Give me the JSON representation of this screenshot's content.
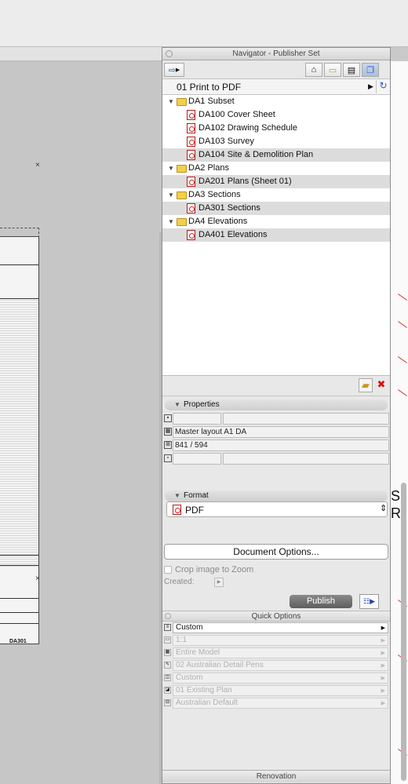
{
  "palette": {
    "title": "Navigator - Publisher Set",
    "publisher_set": "01 Print to PDF"
  },
  "tree": [
    {
      "label": "DA1 Subset",
      "kind": "folder",
      "level": 0,
      "selected": false
    },
    {
      "label": "DA100 Cover Sheet",
      "kind": "pdf",
      "level": 1,
      "selected": false
    },
    {
      "label": "DA102 Drawing Schedule",
      "kind": "pdf",
      "level": 1,
      "selected": false
    },
    {
      "label": "DA103 Survey",
      "kind": "pdf",
      "level": 1,
      "selected": false
    },
    {
      "label": "DA104 Site & Demolition Plan",
      "kind": "pdf",
      "level": 1,
      "selected": true
    },
    {
      "label": "DA2 Plans",
      "kind": "folder",
      "level": 0,
      "selected": false
    },
    {
      "label": "DA201 Plans (Sheet 01)",
      "kind": "pdf",
      "level": 1,
      "selected": true
    },
    {
      "label": "DA3 Sections",
      "kind": "folder",
      "level": 0,
      "selected": false
    },
    {
      "label": "DA301 Sections",
      "kind": "pdf",
      "level": 1,
      "selected": true
    },
    {
      "label": "DA4 Elevations",
      "kind": "folder",
      "level": 0,
      "selected": false
    },
    {
      "label": "DA401 Elevations",
      "kind": "pdf",
      "level": 1,
      "selected": true
    }
  ],
  "properties": {
    "heading": "Properties",
    "master_layout": "Master layout A1 DA",
    "size": "841 / 594"
  },
  "format": {
    "heading": "Format",
    "value": "PDF",
    "document_options": "Document Options...",
    "crop_label": "Crop image to Zoom",
    "created_label": "Created:",
    "publish": "Publish"
  },
  "quick_options": {
    "heading": "Quick Options",
    "rows": [
      "Custom",
      "1:1",
      "Entire Model",
      "02 Australian Detail Pens",
      "Custom",
      "01 Existing Plan",
      "Australian Default"
    ]
  },
  "renovation": {
    "heading": "Renovation"
  },
  "canvas": {
    "sheet_label": "DA301",
    "letter_s": "S",
    "letter_r": "R"
  }
}
